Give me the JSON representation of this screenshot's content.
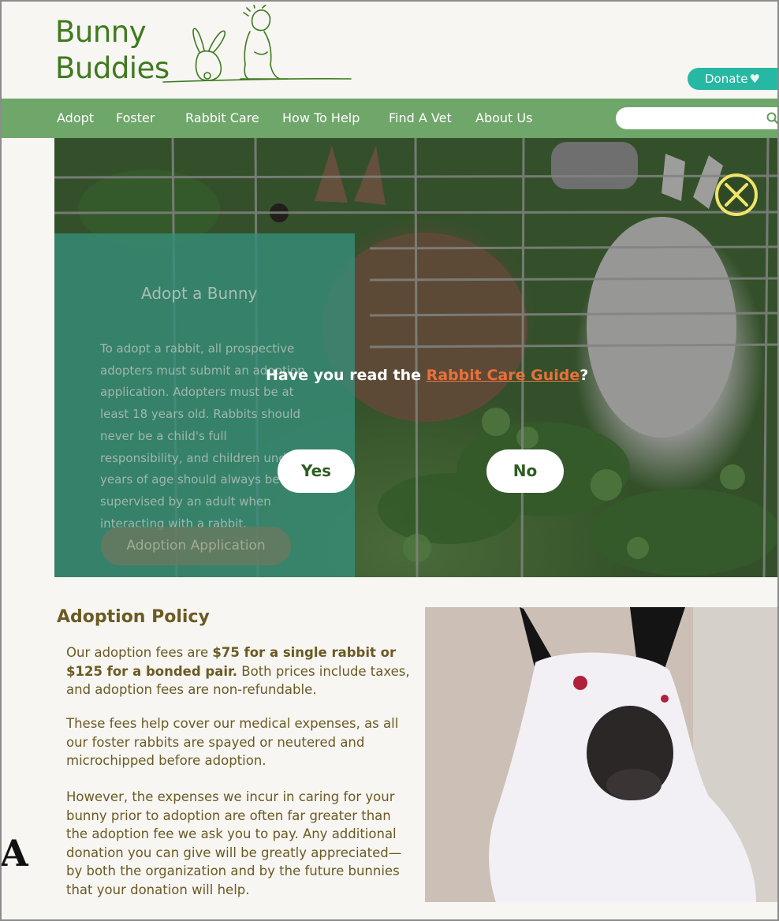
{
  "header": {
    "logo_line1": "Bunny",
    "logo_line2": "Buddies",
    "donate_label": "Donate",
    "donate_icon": "heart-icon"
  },
  "nav": {
    "items": [
      "Adopt",
      "Foster",
      "Rabbit Care",
      "How To Help",
      "Find A Vet",
      "About Us"
    ],
    "search_placeholder": "",
    "search_icon": "search-icon"
  },
  "colors": {
    "brand_green": "#3f7a1f",
    "nav_green": "#6fa76a",
    "donate_teal": "#27b8a3",
    "link_orange": "#e9703b",
    "close_yellow": "#f0e46a",
    "policy_brown": "#6b5a22"
  },
  "hero": {
    "card_title": "Adopt a Bunny",
    "card_text": "To adopt a rabbit, all prospective adopters must submit an adoption application. Adopters must be at least 18 years old. Rabbits should never be a child's full responsibility, and children under 8 years of age should always be supervised by an adult when interacting with a rabbit.",
    "card_button": "Adoption  Application"
  },
  "modal": {
    "question_prefix": "Have you read the ",
    "question_link": "Rabbit Care Guide",
    "question_suffix": "?",
    "yes_label": "Yes",
    "no_label": "No",
    "close_icon": "close-icon"
  },
  "policy": {
    "title": "Adoption Policy",
    "p1_a": "Our adoption fees are ",
    "p1_bold": "$75 for a single rabbit or $125 for a bonded pair.",
    "p1_b": " Both prices include taxes, and adoption fees are non-refundable.",
    "p2": "These fees help cover our medical expenses, as all our foster rabbits are spayed or neutered and microchipped before adoption.",
    "p3": "However, the expenses we incur in caring for your bunny prior to adoption are often far greater than the adoption fee we ask you to pay.  Any additional donation you can give will be greatly appreciated—by both the organization and by the future bunnies that your donation will help."
  },
  "stray_text": "A"
}
